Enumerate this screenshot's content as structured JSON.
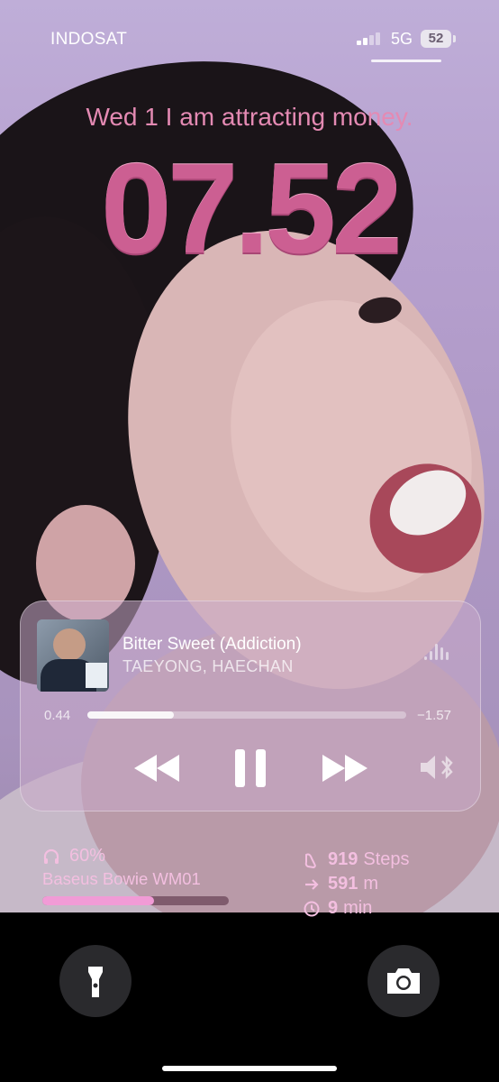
{
  "status_bar": {
    "carrier": "INDOSAT",
    "network": "5G",
    "battery": "52"
  },
  "lock_screen": {
    "date_line": "Wed 1  I am attracting money.",
    "time": "07.52"
  },
  "now_playing": {
    "song": "Bitter Sweet (Addiction)",
    "artist": "TAEYONG, HAECHAN",
    "elapsed": "0.44",
    "remaining": "−1.57",
    "progress": 0.27
  },
  "headphones_widget": {
    "battery": "60%",
    "device": "Baseus Bowie WM01",
    "level": 0.6
  },
  "activity_widget": {
    "steps_value": "919",
    "steps_unit": "Steps",
    "distance_value": "591",
    "distance_unit": "m",
    "time_value": "9",
    "time_unit": "min"
  },
  "icons": [
    "headphones-icon",
    "steps-icon",
    "arrow-right-icon",
    "clock-icon",
    "flashlight-icon",
    "camera-icon",
    "rewind-icon",
    "pause-icon",
    "fast-forward-icon",
    "audio-output-icon",
    "waveform-icon"
  ],
  "colors": {
    "accent_pink": "#e48ab3",
    "widget_text": "#f3bfe0",
    "clock": "#cc5f92"
  }
}
